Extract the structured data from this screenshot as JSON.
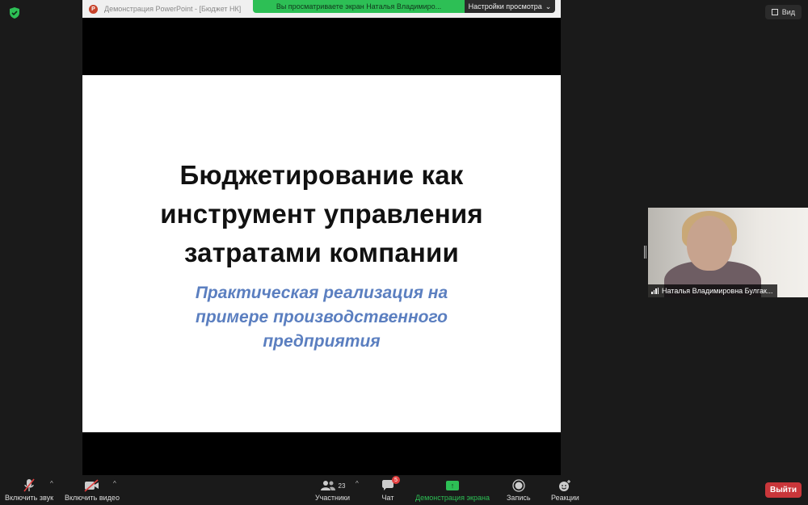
{
  "window": {
    "view_label": "Вид"
  },
  "banner": {
    "message": "Вы просматриваете экран Наталья Владимиро...",
    "options_label": "Настройки просмотра"
  },
  "shared_window": {
    "title": "Демонстрация PowerPoint - [Бюджет НК]",
    "app_icon_letter": "P"
  },
  "slide": {
    "title_lines": [
      "Бюджетирование как",
      "инструмент управления",
      "затратами компании"
    ],
    "subtitle_lines": [
      "Практическая реализация на",
      "примере производственного",
      "предприятия"
    ]
  },
  "participant": {
    "name": "Наталья Владимировна Булгак..."
  },
  "toolbar": {
    "audio_label": "Включить звук",
    "video_label": "Включить видео",
    "participants_label": "Участники",
    "participants_count": "23",
    "chat_label": "Чат",
    "chat_badge": "5",
    "share_label": "Демонстрация экрана",
    "record_label": "Запись",
    "reactions_label": "Реакции",
    "leave_label": "Выйти"
  },
  "colors": {
    "banner_green": "#2dbf55",
    "subtitle_blue": "#5b7fc0",
    "leave_red": "#c9363a"
  }
}
